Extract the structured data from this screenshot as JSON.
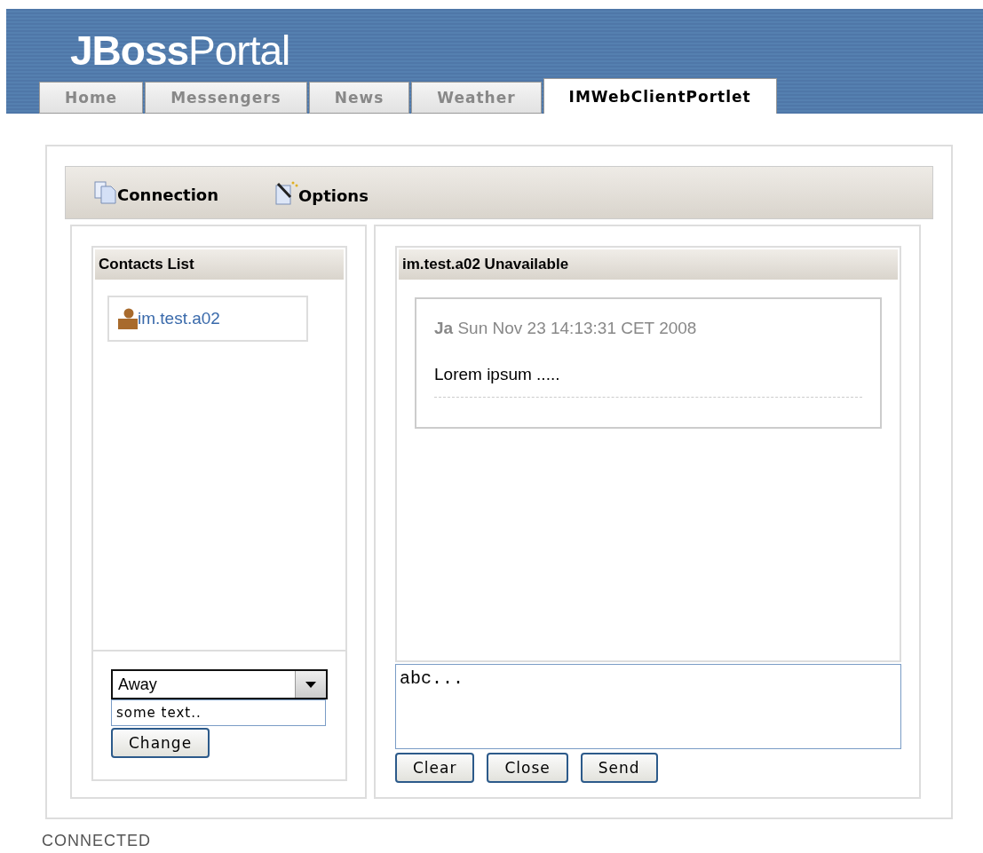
{
  "header": {
    "logo_bold": "JBoss",
    "logo_light": "Portal"
  },
  "tabs": [
    {
      "label": "Home",
      "selected": false
    },
    {
      "label": "Messengers",
      "selected": false
    },
    {
      "label": "News",
      "selected": false
    },
    {
      "label": "Weather",
      "selected": false
    },
    {
      "label": "IMWebClientPortlet",
      "selected": true
    }
  ],
  "toolbar": [
    {
      "label": "Connection",
      "kind": "pages"
    },
    {
      "label": "Options",
      "kind": "wand"
    }
  ],
  "contacts": {
    "title": "Contacts List",
    "items": [
      {
        "name": "im.test.a02"
      }
    ]
  },
  "status": {
    "value": "Away",
    "message": "some text..",
    "button": "Change"
  },
  "chat": {
    "title": "im.test.a02 Unavailable",
    "messages": [
      {
        "header": "**Ja** Sun Nov 23 14:13:31 CET 2008",
        "text": "Lorem ipsum ....."
      }
    ],
    "input": "abc...",
    "buttons": [
      "Clear",
      "Close",
      "Send"
    ]
  },
  "status_bar": "CONNECTED"
}
